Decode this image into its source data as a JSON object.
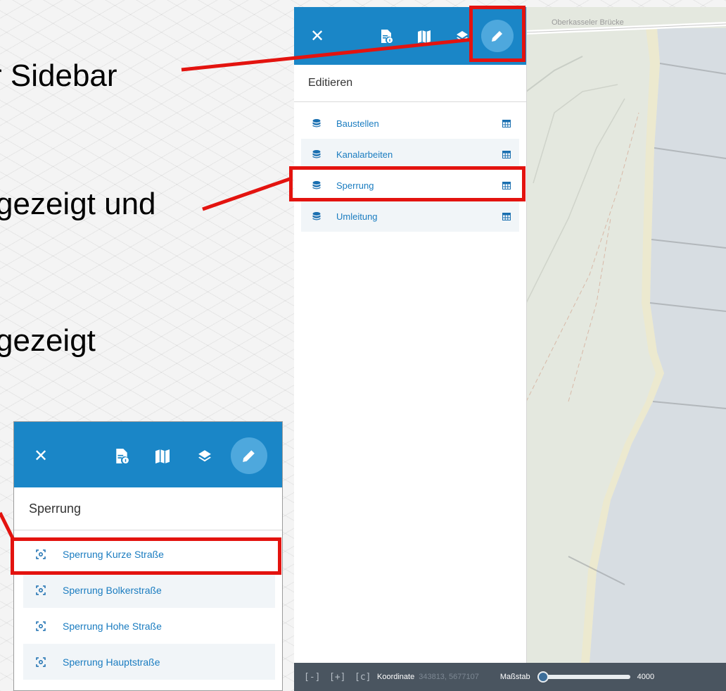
{
  "callouts": {
    "line1": "r Sidebar",
    "line2": "gezeigt und",
    "line3": "gezeigt"
  },
  "main": {
    "panel_title": "Editieren",
    "layers": [
      {
        "label": "Baustellen"
      },
      {
        "label": "Kanalarbeiten"
      },
      {
        "label": "Sperrung"
      },
      {
        "label": "Umleitung"
      }
    ],
    "map_label": "Oberkasseler Brücke",
    "bottombar": {
      "coord_label": "Koordinate",
      "coord_value": "343813, 5677107",
      "scale_label": "Maßstab",
      "scale_value": "4000"
    }
  },
  "inset": {
    "panel_title": "Sperrung",
    "features": [
      {
        "label": "Sperrung Kurze Straße"
      },
      {
        "label": "Sperrung Bolkerstraße"
      },
      {
        "label": "Sperrung Hohe Straße"
      },
      {
        "label": "Sperrung Hauptstraße"
      }
    ]
  },
  "colors": {
    "topbar": "#1a86c7",
    "highlight": "#e3130f",
    "link": "#1a7cc0",
    "bottombar": "#4a5560"
  },
  "icons": [
    "close-icon",
    "feature-info-icon",
    "map-icon",
    "layers-icon",
    "edit-pencil-icon",
    "database-icon",
    "table-icon",
    "zoom-to-feature-icon",
    "zoom-out-icon",
    "zoom-in-icon",
    "reset-view-icon"
  ]
}
